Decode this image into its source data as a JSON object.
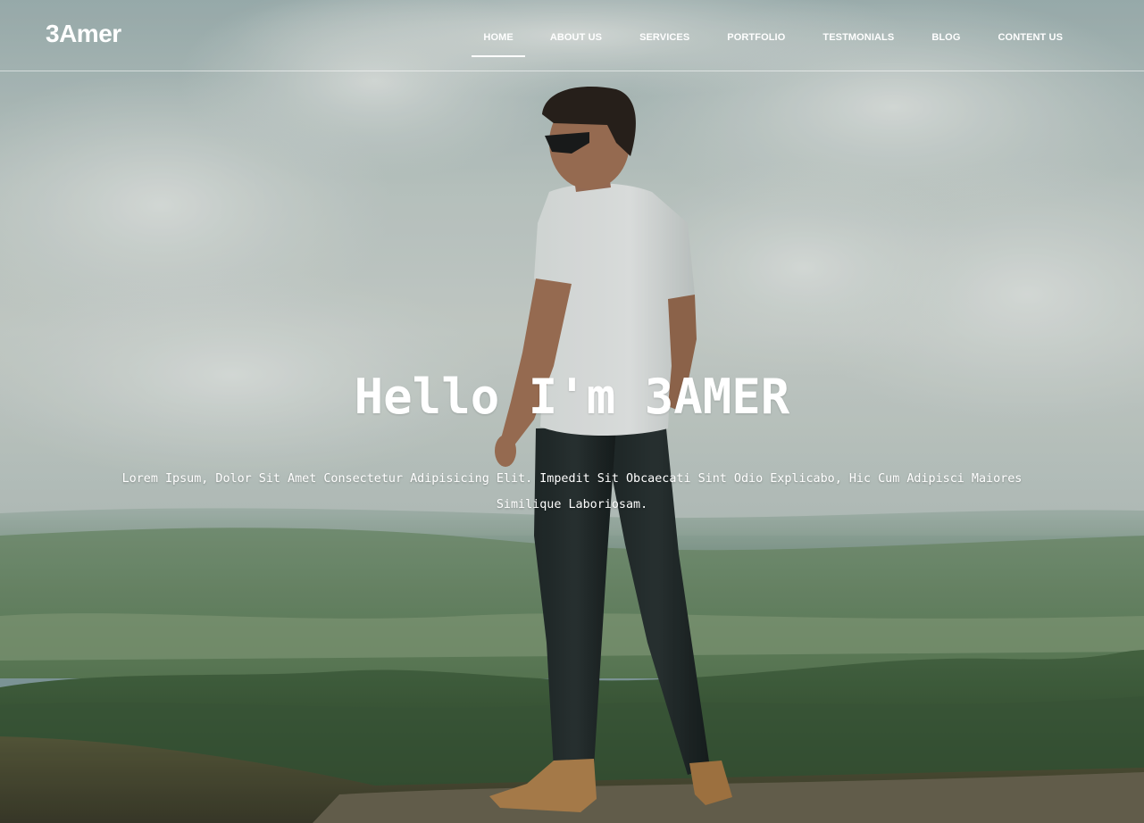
{
  "brand": {
    "name": "3Amer"
  },
  "nav": {
    "items": [
      {
        "label": "HOME",
        "active": true
      },
      {
        "label": "ABOUT US",
        "active": false
      },
      {
        "label": "SERVICES",
        "active": false
      },
      {
        "label": "PORTFOLIO",
        "active": false
      },
      {
        "label": "TESTMONIALS",
        "active": false
      },
      {
        "label": "BLOG",
        "active": false
      },
      {
        "label": "CONTENT US",
        "active": false
      }
    ]
  },
  "hero": {
    "title": "Hello I'm 3AMER",
    "description": "Lorem Ipsum, Dolor Sit Amet Consectetur Adipisicing Elit. Impedit Sit Obcaecati Sint Odio Explicabo, Hic Cum Adipisci Maiores Similique Laboriosam."
  },
  "colors": {
    "text": "#ffffff",
    "sky": "#c9d4d1",
    "hills": "#6f8f6c",
    "forest": "#3f5a3a"
  }
}
